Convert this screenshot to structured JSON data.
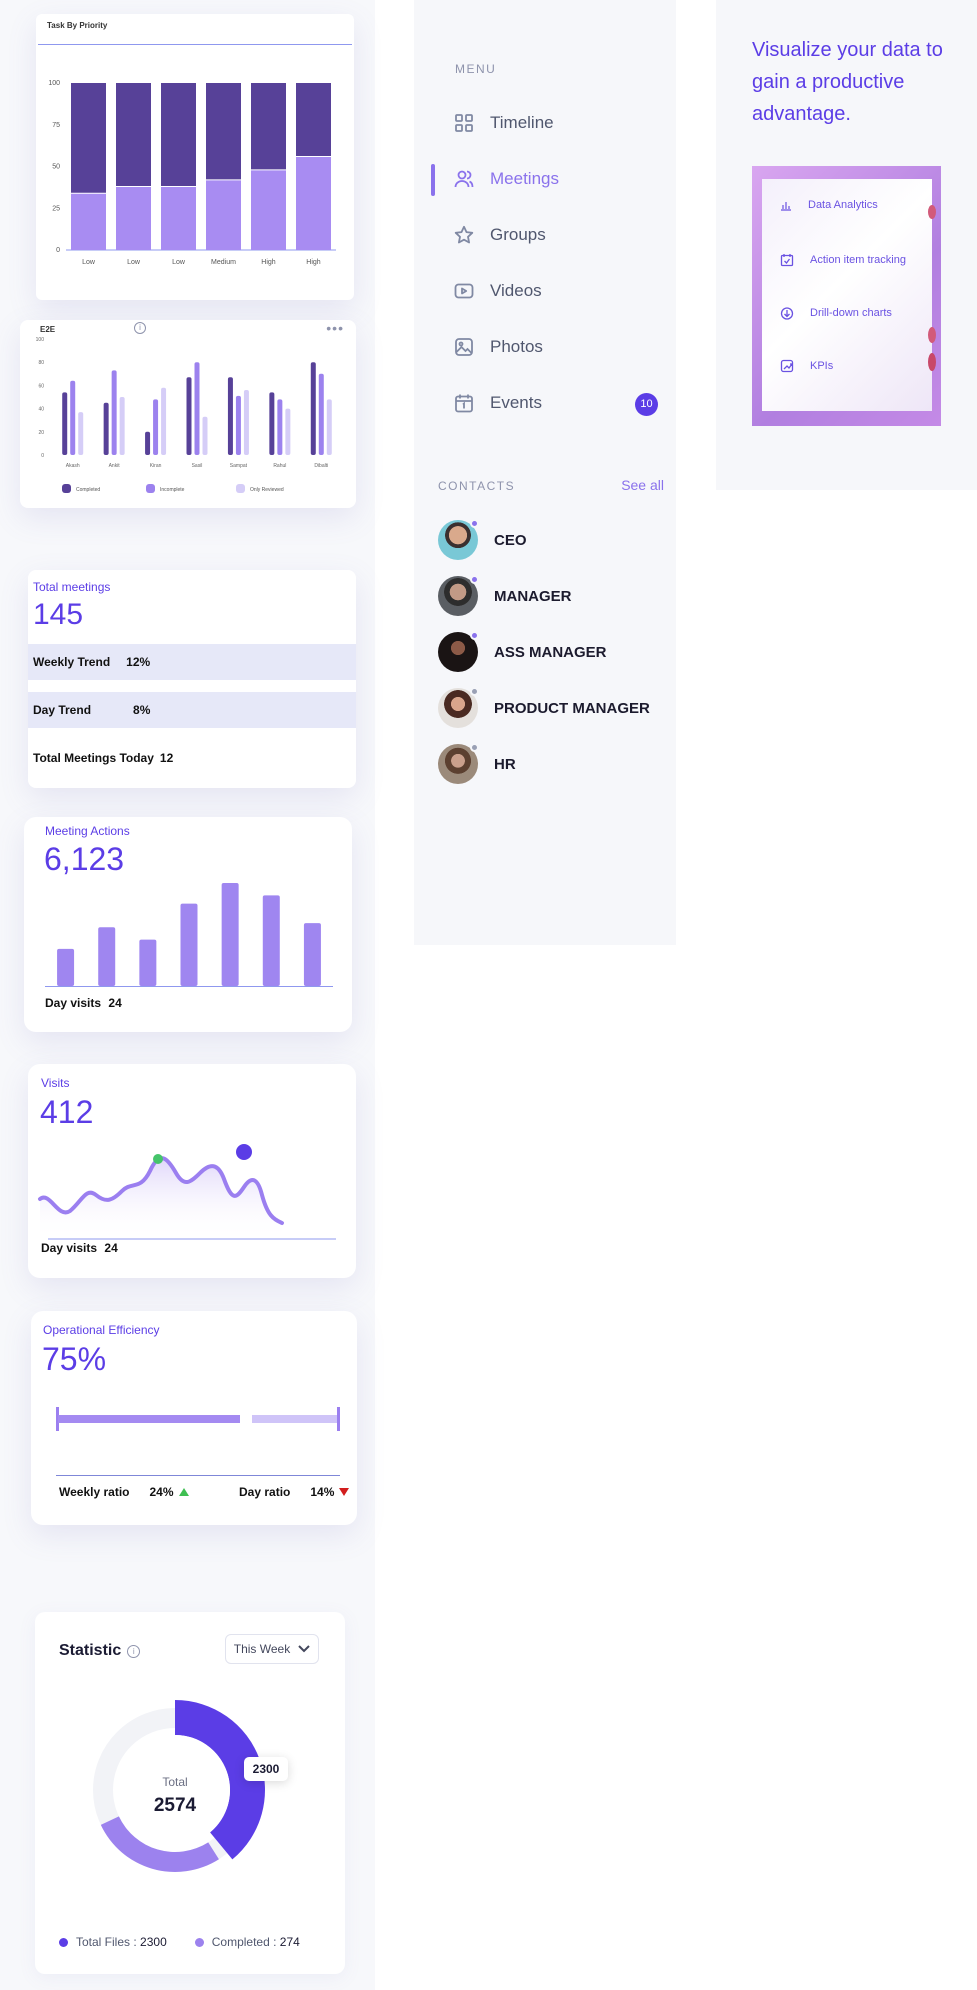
{
  "priority_chart": {
    "title": "Task By Priority",
    "y_ticks": [
      "100",
      "75",
      "50",
      "25",
      "0"
    ],
    "categories": [
      "Low",
      "Low",
      "Low",
      "Medium",
      "High",
      "High"
    ],
    "chart_data": {
      "type": "bar",
      "stacked": true,
      "categories": [
        "Low",
        "Low",
        "Low",
        "Medium",
        "High",
        "High"
      ],
      "series": [
        {
          "values": [
            34,
            38,
            38,
            42,
            48,
            56
          ]
        },
        {
          "values": [
            66,
            62,
            62,
            58,
            52,
            44
          ]
        }
      ],
      "ylim": [
        0,
        100
      ],
      "colors": [
        "#a88cf2",
        "#574198"
      ]
    }
  },
  "e2e_chart": {
    "title": "E2E",
    "y_ticks": [
      "100",
      "80",
      "60",
      "40",
      "20",
      "0"
    ],
    "categories": [
      "Akash",
      "Ankit",
      "Kiran",
      "Sasil",
      "Sampat",
      "Rahul",
      "Dibalti"
    ],
    "legend": [
      "Completed",
      "Incomplete",
      "Only Reviewed"
    ],
    "chart_data": {
      "type": "bar",
      "categories": [
        "Akash",
        "Ankit",
        "Kiran",
        "Sasil",
        "Sampat",
        "Rahul",
        "Dibalti"
      ],
      "series": [
        {
          "name": "Completed",
          "values": [
            54,
            45,
            20,
            67,
            67,
            54,
            80
          ]
        },
        {
          "name": "Incomplete",
          "values": [
            64,
            73,
            48,
            80,
            51,
            48,
            70
          ]
        },
        {
          "name": "Only Reviewed",
          "values": [
            37,
            50,
            58,
            33,
            56,
            40,
            48
          ]
        }
      ],
      "ylim": [
        0,
        100
      ],
      "colors": [
        "#574198",
        "#9c82ee",
        "#d5cdf7"
      ]
    }
  },
  "total_meetings": {
    "label": "Total meetings",
    "value": "145",
    "rows": [
      {
        "label": "Weekly Trend",
        "value": "12%"
      },
      {
        "label": "Day Trend",
        "value": "8%"
      },
      {
        "label": "Total Meetings Today",
        "value": "12"
      }
    ]
  },
  "meeting_actions": {
    "label": "Meeting Actions",
    "value": "6,123",
    "footer_label": "Day visits",
    "footer_value": "24",
    "chart_data": {
      "type": "bar",
      "values": [
        36,
        57,
        45,
        80,
        100,
        88,
        61
      ]
    }
  },
  "visits": {
    "label": "Visits",
    "value": "412",
    "footer_label": "Day visits",
    "footer_value": "24"
  },
  "efficiency": {
    "label": "Operational Efficiency",
    "value": "75%",
    "weekly_label": "Weekly ratio",
    "weekly_value": "24%",
    "day_label": "Day ratio",
    "day_value": "14%"
  },
  "statistic": {
    "title": "Statistic",
    "dropdown": "This Week",
    "center_label": "Total",
    "center_value": "2574",
    "callout": "2300",
    "legend": [
      {
        "label": "Total Files",
        "value": "2300"
      },
      {
        "label": "Completed",
        "value": "274"
      }
    ],
    "chart_data": {
      "type": "pie",
      "labels": [
        "Total Files",
        "Completed"
      ],
      "values": [
        2300,
        274
      ],
      "colors": [
        "#5b3de6",
        "#9c82ee"
      ]
    }
  },
  "menu": {
    "label": "MENU",
    "items": [
      {
        "label": "Timeline",
        "icon": "grid-icon"
      },
      {
        "label": "Meetings",
        "icon": "users-icon"
      },
      {
        "label": "Groups",
        "icon": "star-icon"
      },
      {
        "label": "Videos",
        "icon": "play-icon"
      },
      {
        "label": "Photos",
        "icon": "image-icon"
      },
      {
        "label": "Events",
        "icon": "calendar-icon",
        "badge": "10"
      }
    ]
  },
  "contacts": {
    "label": "CONTACTS",
    "see_all": "See all",
    "items": [
      {
        "name": "CEO"
      },
      {
        "name": "MANAGER"
      },
      {
        "name": "ASS MANAGER"
      },
      {
        "name": "PRODUCT MANAGER"
      },
      {
        "name": "HR"
      }
    ]
  },
  "promo": {
    "headline": "Visualize your  data to gain a productive advantage.",
    "features": [
      {
        "label": "Data Analytics",
        "icon": "bar-chart-icon"
      },
      {
        "label": "Action item tracking",
        "icon": "check-calendar-icon"
      },
      {
        "label": "Drill-down charts",
        "icon": "download-circle-icon"
      },
      {
        "label": "KPIs",
        "icon": "trend-icon"
      }
    ]
  }
}
